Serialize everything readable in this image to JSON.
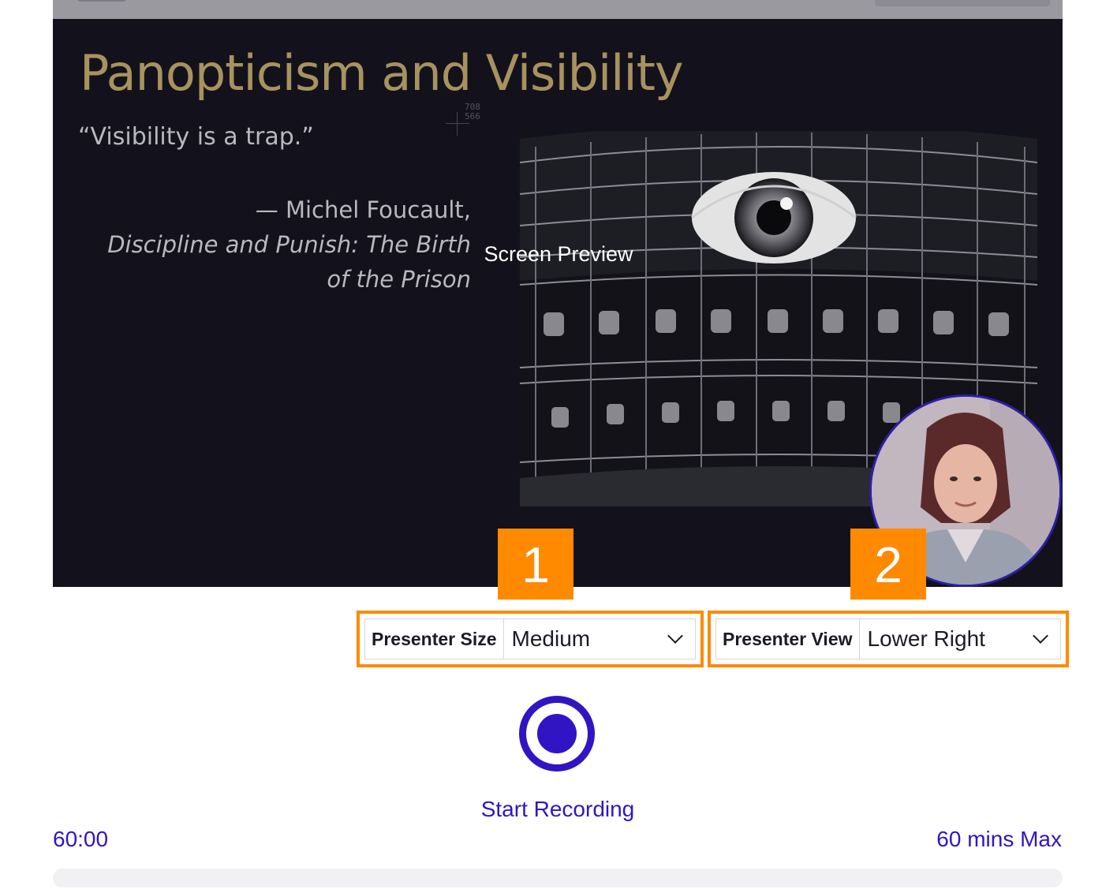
{
  "slide": {
    "title": "Panopticism and Visibility",
    "quote": "“Visibility is a trap.”",
    "attribution_author": "— Michel Foucault,",
    "attribution_book_line1": "Discipline and Punish: The Birth",
    "attribution_book_line2": "of the Prison"
  },
  "cursor_readout": "708\n566",
  "preview_label": "Screen Preview",
  "annotations": {
    "badge_1": "1",
    "badge_2": "2"
  },
  "controls": {
    "presenter_size": {
      "label": "Presenter Size",
      "value": "Medium"
    },
    "presenter_view": {
      "label": "Presenter View",
      "value": "Lower Right"
    }
  },
  "recording": {
    "start_label": "Start Recording",
    "timer": "60:00",
    "max": "60 mins Max",
    "progress": 0
  },
  "colors": {
    "accent": "#3115c4",
    "annotation": "#ff8a00",
    "slide_background": "#13121c",
    "slide_title": "#a8925e"
  }
}
